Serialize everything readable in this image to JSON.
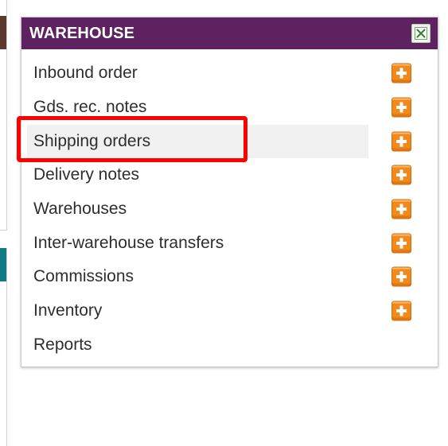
{
  "panel": {
    "title": "WAREHOUSE",
    "close_icon": "close-icon",
    "header_color": "#5e2260",
    "items": [
      {
        "label": "Inbound order",
        "has_add": true
      },
      {
        "label": "Gds. rec. notes",
        "has_add": true
      },
      {
        "label": "Shipping orders",
        "has_add": true,
        "selected": true
      },
      {
        "label": "Delivery notes",
        "has_add": true
      },
      {
        "label": "Warehouses",
        "has_add": true
      },
      {
        "label": "Inter-warehouse transfers",
        "has_add": true
      },
      {
        "label": "Commissions",
        "has_add": true
      },
      {
        "label": "Inventory",
        "has_add": true
      },
      {
        "label": "Reports",
        "has_add": false
      }
    ],
    "add_icon": "plus-icon",
    "add_color": "#f08a1d",
    "highlight_color": "#ff0000"
  }
}
